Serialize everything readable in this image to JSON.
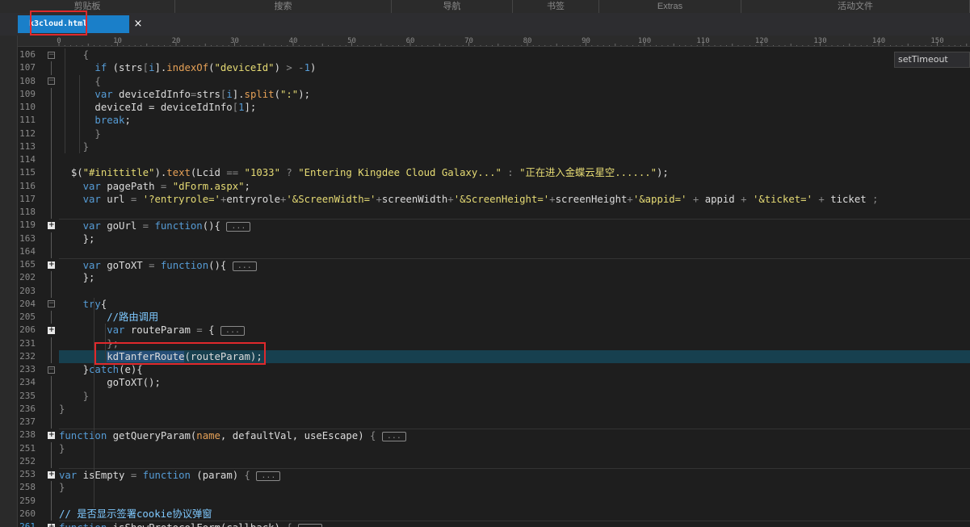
{
  "ribbon": [
    {
      "label": "剪贴板",
      "w": 217
    },
    {
      "label": "搜索",
      "w": 268
    },
    {
      "label": "导航",
      "w": 150
    },
    {
      "label": "书签",
      "w": 107
    },
    {
      "label": "Extras",
      "w": 176
    },
    {
      "label": "活动文件",
      "w": 283
    }
  ],
  "tab": {
    "title": "k3cloud.html",
    "close": "×"
  },
  "tooltip": {
    "text": "setTimeout"
  },
  "ruler": {
    "labels": [
      "0",
      "10",
      "20",
      "30",
      "40",
      "50",
      "60",
      "70",
      "80",
      "90",
      "100",
      "110",
      "120",
      "130",
      "140",
      "150"
    ]
  },
  "colors": {
    "keyword": "#569cd6",
    "string": "#e6db74",
    "func": "#e6a157",
    "op": "#8a8a8a",
    "comment": "#7fc9ff",
    "text": "#dcdcdc",
    "collapse": "#8a8a8a",
    "highlight": "#e0292c",
    "active_line": "#17404f",
    "tab": "#1a7fc9"
  },
  "lines": [
    {
      "n": "106",
      "fold": "open",
      "segs": [
        [
          "    ",
          "t"
        ],
        [
          "{",
          "o"
        ]
      ]
    },
    {
      "n": "107",
      "segs": [
        [
          "      ",
          "t"
        ],
        [
          "if",
          "k"
        ],
        [
          " (strs",
          "t"
        ],
        [
          "[",
          "o"
        ],
        [
          "i",
          "k"
        ],
        [
          "].",
          "t"
        ],
        [
          "indexOf",
          "f"
        ],
        [
          "(",
          "t"
        ],
        [
          "\"deviceId\"",
          "s"
        ],
        [
          ") ",
          "t"
        ],
        [
          "> -",
          "o"
        ],
        [
          "1",
          "k"
        ],
        [
          ")",
          "t"
        ]
      ]
    },
    {
      "n": "108",
      "fold": "open",
      "segs": [
        [
          "      ",
          "t"
        ],
        [
          "{",
          "o"
        ]
      ]
    },
    {
      "n": "109",
      "segs": [
        [
          "      ",
          "t"
        ],
        [
          "var",
          "k"
        ],
        [
          " deviceIdInfo",
          "t"
        ],
        [
          "=",
          "o"
        ],
        [
          "strs",
          "t"
        ],
        [
          "[",
          "o"
        ],
        [
          "i",
          "k"
        ],
        [
          "].",
          "t"
        ],
        [
          "split",
          "f"
        ],
        [
          "(",
          "t"
        ],
        [
          "\":\"",
          "s"
        ],
        [
          ");",
          "t"
        ]
      ]
    },
    {
      "n": "110",
      "segs": [
        [
          "      ",
          "t"
        ],
        [
          "deviceId = deviceIdInfo",
          "t"
        ],
        [
          "[",
          "o"
        ],
        [
          "1",
          "k"
        ],
        [
          "];",
          "t"
        ]
      ]
    },
    {
      "n": "111",
      "segs": [
        [
          "      ",
          "t"
        ],
        [
          "break",
          "k"
        ],
        [
          ";",
          "t"
        ]
      ]
    },
    {
      "n": "112",
      "segs": [
        [
          "      ",
          "t"
        ],
        [
          "}",
          "o"
        ]
      ]
    },
    {
      "n": "113",
      "segs": [
        [
          "    ",
          "t"
        ],
        [
          "}",
          "o"
        ]
      ]
    },
    {
      "n": "114",
      "segs": []
    },
    {
      "n": "115",
      "segs": [
        [
          "  ",
          "t"
        ],
        [
          "$(",
          "t"
        ],
        [
          "\"#inittitle\"",
          "s"
        ],
        [
          ").",
          "t"
        ],
        [
          "text",
          "f"
        ],
        [
          "(Lcid ",
          "t"
        ],
        [
          "==",
          "o"
        ],
        [
          " ",
          "t"
        ],
        [
          "\"1033\"",
          "s"
        ],
        [
          " ? ",
          "o"
        ],
        [
          "\"Entering Kingdee Cloud Galaxy...\"",
          "s"
        ],
        [
          " : ",
          "o"
        ],
        [
          "\"正在进入金蝶云星空......\"",
          "s"
        ],
        [
          ");",
          "t"
        ]
      ]
    },
    {
      "n": "116",
      "segs": [
        [
          "    ",
          "t"
        ],
        [
          "var",
          "k"
        ],
        [
          " pagePath ",
          "t"
        ],
        [
          "=",
          "o"
        ],
        [
          " ",
          "t"
        ],
        [
          "\"dForm.aspx\"",
          "s"
        ],
        [
          ";",
          "t"
        ]
      ]
    },
    {
      "n": "117",
      "segs": [
        [
          "    ",
          "t"
        ],
        [
          "var",
          "k"
        ],
        [
          " url ",
          "t"
        ],
        [
          "=",
          "o"
        ],
        [
          " ",
          "t"
        ],
        [
          "'?entryrole='",
          "s"
        ],
        [
          "+",
          "o"
        ],
        [
          "entryrole",
          "t"
        ],
        [
          "+",
          "o"
        ],
        [
          "'&ScreenWidth='",
          "s"
        ],
        [
          "+",
          "o"
        ],
        [
          "screenWidth",
          "t"
        ],
        [
          "+",
          "o"
        ],
        [
          "'&ScreenHeight='",
          "s"
        ],
        [
          "+",
          "o"
        ],
        [
          "screenHeight",
          "t"
        ],
        [
          "+",
          "o"
        ],
        [
          "'&appid='",
          "s"
        ],
        [
          " + ",
          "o"
        ],
        [
          "appid",
          "t"
        ],
        [
          " + ",
          "o"
        ],
        [
          "'&ticket='",
          "s"
        ],
        [
          " + ",
          "o"
        ],
        [
          "ticket ",
          "t"
        ],
        [
          ";",
          "o"
        ]
      ]
    },
    {
      "n": "118",
      "segs": []
    },
    {
      "n": "119",
      "fold": "closed",
      "sep": true,
      "segs": [
        [
          "    ",
          "t"
        ],
        [
          "var",
          "k"
        ],
        [
          " goUrl ",
          "t"
        ],
        [
          "=",
          "o"
        ],
        [
          " ",
          "t"
        ],
        [
          "function",
          "k"
        ],
        [
          "(){ ",
          "t"
        ],
        [
          "...",
          "c"
        ]
      ]
    },
    {
      "n": "163",
      "segs": [
        [
          "    ",
          "t"
        ],
        [
          "};",
          "t"
        ]
      ]
    },
    {
      "n": "164",
      "segs": []
    },
    {
      "n": "165",
      "fold": "closed",
      "sep": true,
      "segs": [
        [
          "    ",
          "t"
        ],
        [
          "var",
          "k"
        ],
        [
          " goToXT ",
          "t"
        ],
        [
          "=",
          "o"
        ],
        [
          " ",
          "t"
        ],
        [
          "function",
          "k"
        ],
        [
          "(){ ",
          "t"
        ],
        [
          "...",
          "c"
        ]
      ]
    },
    {
      "n": "202",
      "segs": [
        [
          "    ",
          "t"
        ],
        [
          "};",
          "t"
        ]
      ]
    },
    {
      "n": "203",
      "segs": []
    },
    {
      "n": "204",
      "fold": "open",
      "segs": [
        [
          "    ",
          "t"
        ],
        [
          "try",
          "k"
        ],
        [
          "{",
          "t"
        ]
      ]
    },
    {
      "n": "205",
      "segs": [
        [
          "        ",
          "t"
        ],
        [
          "//路由调用",
          "m"
        ]
      ]
    },
    {
      "n": "206",
      "fold": "closed",
      "segs": [
        [
          "        ",
          "t"
        ],
        [
          "var",
          "k"
        ],
        [
          " routeParam ",
          "t"
        ],
        [
          "=",
          "o"
        ],
        [
          " { ",
          "t"
        ],
        [
          "...",
          "c"
        ]
      ]
    },
    {
      "n": "231",
      "segs": [
        [
          "        ",
          "t"
        ],
        [
          "};",
          "o"
        ]
      ]
    },
    {
      "n": "232",
      "active": true,
      "segs": [
        [
          "        ",
          "t"
        ],
        [
          "kdTanferRoute",
          "sel"
        ],
        [
          "(routeParam);",
          "t"
        ]
      ]
    },
    {
      "n": "233",
      "fold": "open",
      "segs": [
        [
          "    ",
          "t"
        ],
        [
          "}",
          "t"
        ],
        [
          "catch",
          "k"
        ],
        [
          "(e){",
          "t"
        ]
      ]
    },
    {
      "n": "234",
      "segs": [
        [
          "        ",
          "t"
        ],
        [
          "goToXT",
          "t"
        ],
        [
          "();",
          "t"
        ]
      ]
    },
    {
      "n": "235",
      "segs": [
        [
          "    ",
          "t"
        ],
        [
          "}",
          "o"
        ]
      ]
    },
    {
      "n": "236",
      "segs": [
        [
          "",
          "t"
        ],
        [
          "}",
          "o"
        ]
      ]
    },
    {
      "n": "237",
      "segs": []
    },
    {
      "n": "238",
      "fold": "closed",
      "sep": true,
      "segs": [
        [
          "function",
          "k"
        ],
        [
          " ",
          "t"
        ],
        [
          "getQueryParam",
          "t"
        ],
        [
          "(",
          "t"
        ],
        [
          "name",
          "f"
        ],
        [
          ", defaultVal, useEscape) ",
          "t"
        ],
        [
          "{ ",
          "o"
        ],
        [
          "...",
          "c"
        ]
      ]
    },
    {
      "n": "251",
      "segs": [
        [
          "",
          "t"
        ],
        [
          "}",
          "o"
        ]
      ]
    },
    {
      "n": "252",
      "segs": []
    },
    {
      "n": "253",
      "fold": "closed",
      "sep": true,
      "segs": [
        [
          "var",
          "k"
        ],
        [
          " isEmpty ",
          "t"
        ],
        [
          "=",
          "o"
        ],
        [
          " ",
          "t"
        ],
        [
          "function",
          "k"
        ],
        [
          " (param) ",
          "t"
        ],
        [
          "{ ",
          "o"
        ],
        [
          "...",
          "c"
        ]
      ]
    },
    {
      "n": "258",
      "segs": [
        [
          "",
          "t"
        ],
        [
          "}",
          "o"
        ]
      ]
    },
    {
      "n": "259",
      "segs": []
    },
    {
      "n": "260",
      "segs": [
        [
          "",
          "t"
        ],
        [
          "// 是否显示签署cookie协议弹窗",
          "m"
        ]
      ]
    },
    {
      "n": "261",
      "fold": "closed",
      "sep": true,
      "current": true,
      "segs": [
        [
          "function",
          "k"
        ],
        [
          " isShowProtocolForm(callback) ",
          "t"
        ],
        [
          "{ ",
          "o"
        ],
        [
          "...",
          "c"
        ]
      ]
    }
  ]
}
